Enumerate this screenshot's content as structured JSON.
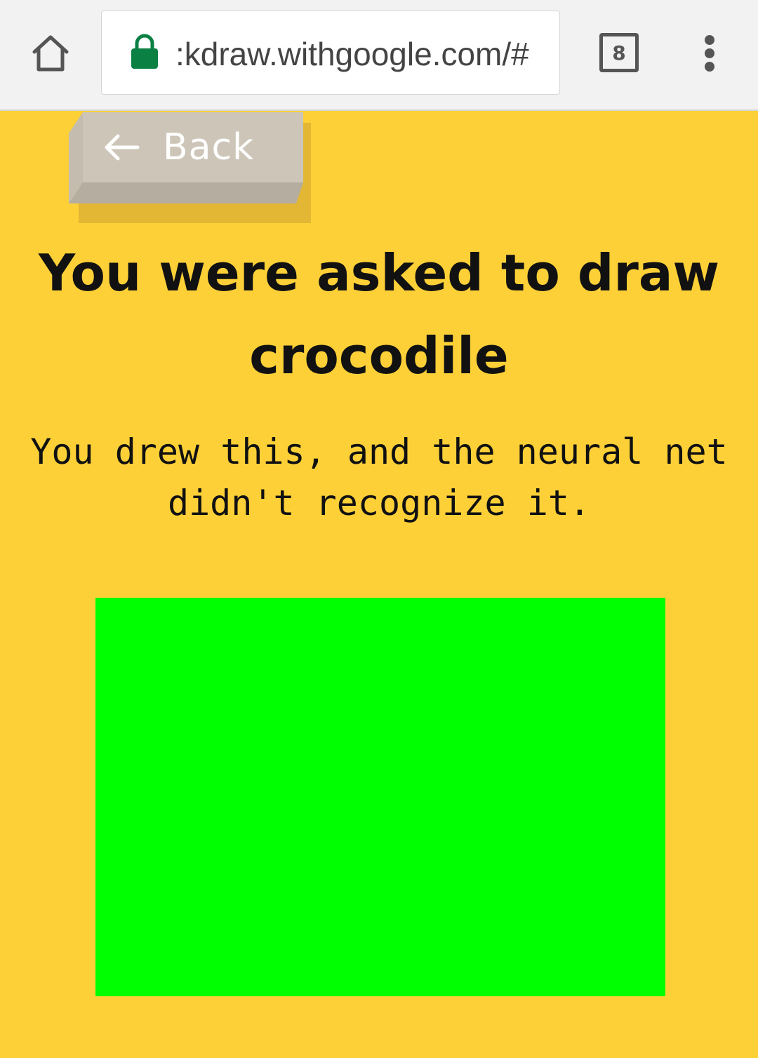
{
  "browser": {
    "url": ":kdraw.withgoogle.com/#",
    "tab_count": "8",
    "home_icon": "home-icon",
    "lock_icon": "lock-icon",
    "menu_icon": "more-vert-icon",
    "lock_color": "#0b8043"
  },
  "page": {
    "background_color": "#fdd037",
    "back_button": {
      "label": "Back",
      "icon": "arrow-left-icon"
    },
    "headline": {
      "line1": "You were asked to draw",
      "prompt": "crocodile"
    },
    "description": "You drew this, and the neural net didn't recognize it.",
    "drawing_color": "#00ff00"
  }
}
